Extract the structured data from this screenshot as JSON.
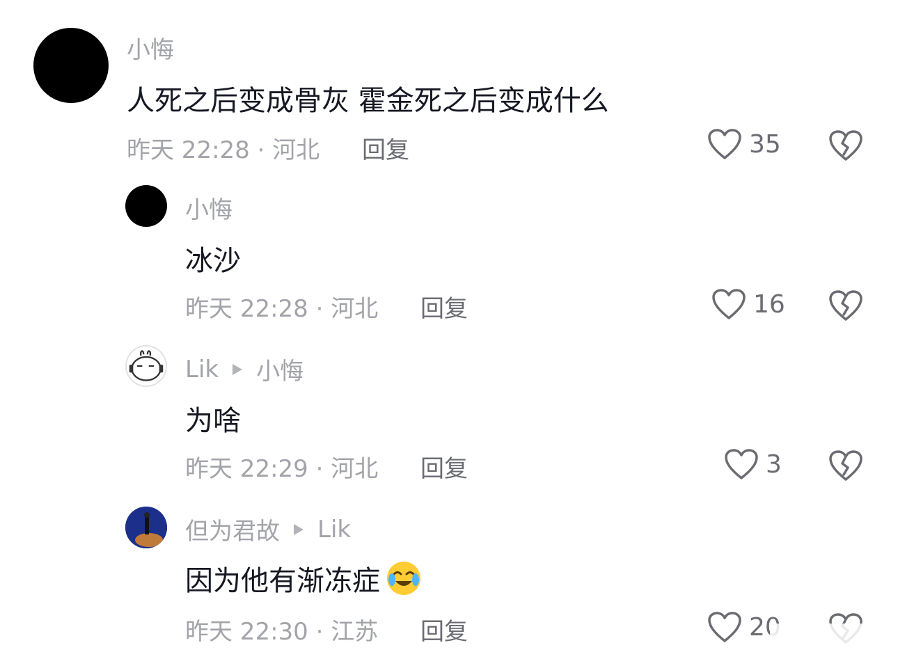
{
  "comments": [
    {
      "user": "小悔",
      "reply_to": "",
      "text": "人死之后变成骨灰 霍金死之后变成什么",
      "meta": "昨天 22:28 · 河北",
      "reply_label": "回复",
      "likes": "35",
      "avatar": "black-circle"
    },
    {
      "user": "小悔",
      "reply_to": "",
      "text": "冰沙",
      "meta": "昨天 22:28 · 河北",
      "reply_label": "回复",
      "likes": "16",
      "avatar": "black-circle"
    },
    {
      "user": "Lik",
      "reply_to": "小悔",
      "text": "为啥",
      "meta": "昨天 22:29 · 河北",
      "reply_label": "回复",
      "likes": "3",
      "avatar": "cartoon-face"
    },
    {
      "user": "但为君故",
      "reply_to": "Lik",
      "text": "因为他有渐冻症",
      "meta": "昨天 22:30 · 江苏",
      "reply_label": "回复",
      "likes": "20",
      "avatar": "photo-dark-blue",
      "emoji": "crying-laughing-emoji"
    }
  ],
  "icons": {
    "like": "heart-outline-icon",
    "dislike": "broken-heart-icon",
    "reply_arrow": "triangle-right-icon"
  },
  "colors": {
    "text_primary": "#161823",
    "text_secondary": "#a3a4a9",
    "action": "#6b6c72"
  }
}
